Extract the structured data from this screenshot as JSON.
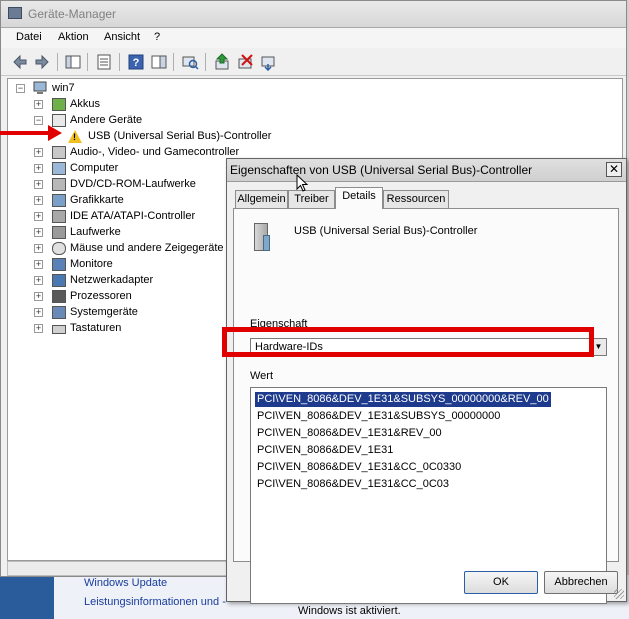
{
  "background": {
    "links": [
      "Windows Update",
      "Leistungsinformationen und -"
    ],
    "status": "Windows ist aktiviert."
  },
  "main_window": {
    "title": "Geräte-Manager",
    "menu": [
      "Datei",
      "Aktion",
      "Ansicht",
      "?"
    ],
    "toolbar_icons": [
      "back-icon",
      "forward-icon",
      "show-hide-console-tree-icon",
      "properties-icon",
      "help-icon",
      "action-pane-icon",
      "scan-hardware-icon",
      "update-driver-icon",
      "uninstall-icon",
      "enable-device-icon"
    ],
    "tree": {
      "root": "win7",
      "items": [
        {
          "label": "Akkus",
          "icon": "battery-icon"
        },
        {
          "label": "Andere Geräte",
          "icon": "unknown-device-icon",
          "expanded": true,
          "children": [
            {
              "label": "USB (Universal Serial Bus)-Controller",
              "icon": "warning-icon"
            }
          ]
        },
        {
          "label": "Audio-, Video- und Gamecontroller",
          "icon": "speaker-icon"
        },
        {
          "label": "Computer",
          "icon": "computer-icon"
        },
        {
          "label": "DVD/CD-ROM-Laufwerke",
          "icon": "dvd-drive-icon"
        },
        {
          "label": "Grafikkarte",
          "icon": "display-adapter-icon"
        },
        {
          "label": "IDE ATA/ATAPI-Controller",
          "icon": "ide-controller-icon"
        },
        {
          "label": "Laufwerke",
          "icon": "disk-drive-icon"
        },
        {
          "label": "Mäuse und andere Zeigegeräte",
          "icon": "mouse-icon"
        },
        {
          "label": "Monitore",
          "icon": "monitor-icon"
        },
        {
          "label": "Netzwerkadapter",
          "icon": "network-adapter-icon"
        },
        {
          "label": "Prozessoren",
          "icon": "processor-icon"
        },
        {
          "label": "Systemgeräte",
          "icon": "system-devices-icon"
        },
        {
          "label": "Tastaturen",
          "icon": "keyboard-icon"
        }
      ]
    }
  },
  "dialog": {
    "title": "Eigenschaften von USB (Universal Serial Bus)-Controller",
    "close_label": "✕",
    "tabs": [
      "Allgemein",
      "Treiber",
      "Details",
      "Ressourcen"
    ],
    "active_tab": "Details",
    "device_name": "USB (Universal Serial Bus)-Controller",
    "property_label": "Eigenschaft",
    "property_value": "Hardware-IDs",
    "value_label": "Wert",
    "values": [
      "PCI\\VEN_8086&DEV_1E31&SUBSYS_00000000&REV_00",
      "PCI\\VEN_8086&DEV_1E31&SUBSYS_00000000",
      "PCI\\VEN_8086&DEV_1E31&REV_00",
      "PCI\\VEN_8086&DEV_1E31",
      "PCI\\VEN_8086&DEV_1E31&CC_0C0330",
      "PCI\\VEN_8086&DEV_1E31&CC_0C03"
    ],
    "selected_index": 0,
    "ok_label": "OK",
    "cancel_label": "Abbrechen"
  },
  "colors": {
    "annotation_red": "#e00000",
    "selection_blue": "#1d3a8c",
    "warning_yellow": "#f0c020"
  }
}
